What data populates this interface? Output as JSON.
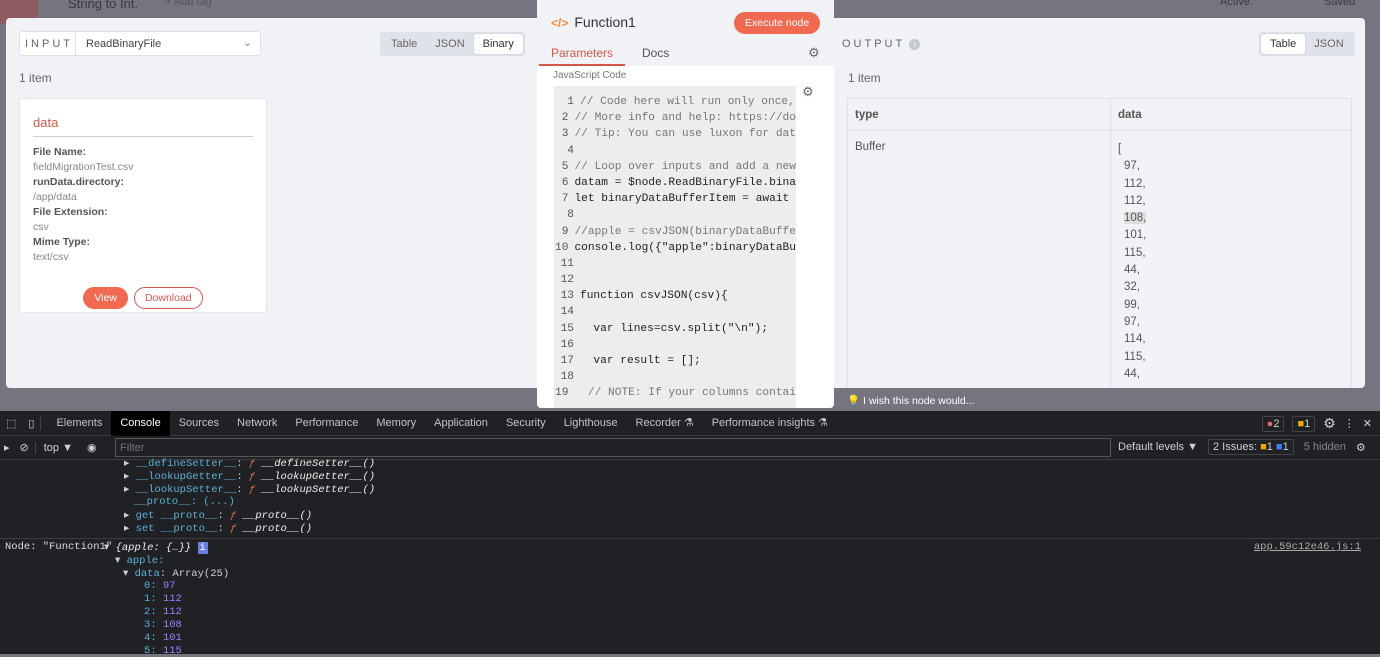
{
  "topbar": {
    "workflow_name": "String to Int.",
    "add_tag": "+ Add tag",
    "active_label": "Active:",
    "saved": "Saved"
  },
  "input": {
    "label": "INPUT",
    "node": "ReadBinaryFile",
    "views": [
      "Table",
      "JSON",
      "Binary"
    ],
    "active_view": "Binary",
    "count": "1 item",
    "card": {
      "title": "data",
      "fields": [
        {
          "key": "File Name:",
          "value": "fieldMigrationTest.csv"
        },
        {
          "key": "runData.directory:",
          "value": "/app/data"
        },
        {
          "key": "File Extension:",
          "value": "csv"
        },
        {
          "key": "Mime Type:",
          "value": "text/csv"
        }
      ],
      "view": "View",
      "download": "Download"
    }
  },
  "node": {
    "title": "Function1",
    "execute": "Execute node",
    "tabs": [
      "Parameters",
      "Docs"
    ],
    "field_label": "JavaScript Code",
    "code": [
      {
        "n": "1",
        "t": "// Code here will run only once,",
        "c": true
      },
      {
        "n": "2",
        "t": "// More info and help: https://do",
        "c": true
      },
      {
        "n": "3",
        "t": "// Tip: You can use luxon for dat",
        "c": true
      },
      {
        "n": "4",
        "t": ""
      },
      {
        "n": "5",
        "t": "// Loop over inputs and add a new",
        "c": true
      },
      {
        "n": "6",
        "t": "datam = $node.ReadBinaryFile.bina"
      },
      {
        "n": "7",
        "t": "let binaryDataBufferItem = await "
      },
      {
        "n": "8",
        "t": ""
      },
      {
        "n": "9",
        "t": "//apple = csvJSON(binaryDataBuffe",
        "c": true
      },
      {
        "n": "10",
        "t": "console.log({\"apple\":binaryDataBu"
      },
      {
        "n": "11",
        "t": ""
      },
      {
        "n": "12",
        "t": ""
      },
      {
        "n": "13",
        "t": "function csvJSON(csv){"
      },
      {
        "n": "14",
        "t": ""
      },
      {
        "n": "15",
        "t": "  var lines=csv.split(\"\\n\");"
      },
      {
        "n": "16",
        "t": ""
      },
      {
        "n": "17",
        "t": "  var result = [];"
      },
      {
        "n": "18",
        "t": ""
      },
      {
        "n": "19",
        "t": "  // NOTE: If your columns contai",
        "c": true
      }
    ]
  },
  "output": {
    "label": "OUTPUT",
    "views": [
      "Table",
      "JSON"
    ],
    "active_view": "Table",
    "count": "1 item",
    "columns": [
      "type",
      "data"
    ],
    "type_value": "Buffer",
    "data_open": "[",
    "data_items": [
      "97,",
      "112,",
      "112,",
      "108,",
      "101,",
      "115,",
      "44,",
      "32,",
      "99,",
      "97,",
      "114,",
      "115,",
      "44,"
    ],
    "wish": "I wish this node would..."
  },
  "devtools": {
    "tabs": [
      "Elements",
      "Console",
      "Sources",
      "Network",
      "Performance",
      "Memory",
      "Application",
      "Security",
      "Lighthouse",
      "Recorder ⚗",
      "Performance insights ⚗"
    ],
    "active_tab": "Console",
    "context": "top ▼",
    "filter_placeholder": "Filter",
    "levels": "Default levels ▼",
    "issues": "2 Issues:",
    "issue_warn": "1",
    "issue_info": "1",
    "hidden": "5 hidden",
    "errors": "2",
    "warnings": "1",
    "proto_lines": [
      {
        "k": "__defineSetter__",
        "f": "__defineSetter__()"
      },
      {
        "k": "__lookupGetter__",
        "f": "__lookupGetter__()"
      },
      {
        "k": "__lookupSetter__",
        "f": "__lookupSetter__()"
      }
    ],
    "proto_plain": "__proto__: (...)",
    "get_proto": "get __proto__",
    "set_proto": "set __proto__",
    "proto_fn": "__proto__()",
    "log_prefix": "Node: \"Function1\"",
    "log_obj": "{apple: {…}}",
    "source": "app.59c12e46.js:1",
    "apple_key": "apple:",
    "data_key": "data",
    "data_type": "Array(25)",
    "entries": [
      {
        "i": "0",
        "v": "97"
      },
      {
        "i": "1",
        "v": "112"
      },
      {
        "i": "2",
        "v": "112"
      },
      {
        "i": "3",
        "v": "108"
      },
      {
        "i": "4",
        "v": "101"
      },
      {
        "i": "5",
        "v": "115"
      }
    ]
  }
}
